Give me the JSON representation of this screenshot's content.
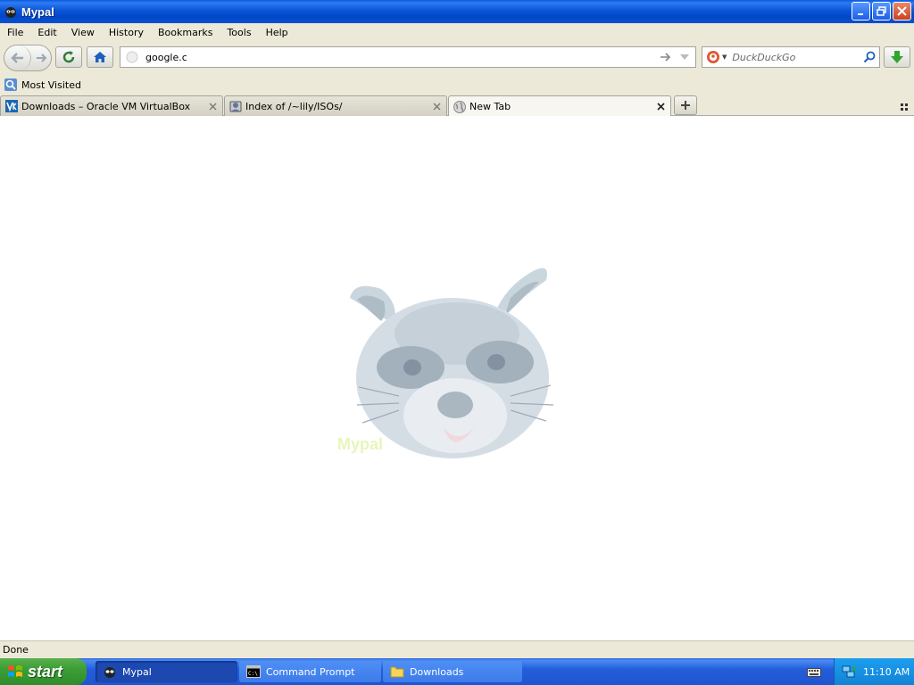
{
  "window": {
    "title": "Mypal"
  },
  "menu": [
    "File",
    "Edit",
    "View",
    "History",
    "Bookmarks",
    "Tools",
    "Help"
  ],
  "navbar": {
    "url_value": "google.c",
    "search_placeholder": "DuckDuckGo"
  },
  "bookmarks": {
    "most_visited": "Most Visited"
  },
  "tabs": [
    {
      "label": "Downloads – Oracle VM VirtualBox",
      "icon": "virtualbox-icon",
      "selected": false
    },
    {
      "label": "Index of /~lily/ISOs/",
      "icon": "directory-icon",
      "selected": false
    },
    {
      "label": "New Tab",
      "icon": "globe-icon",
      "selected": true
    }
  ],
  "content": {
    "mascot_caption": "Mypal"
  },
  "status": {
    "text": "Done"
  },
  "taskbar": {
    "start": "start",
    "tasks": [
      {
        "label": "Mypal",
        "active": true
      },
      {
        "label": "Command Prompt",
        "active": false
      },
      {
        "label": "Downloads",
        "active": false
      }
    ],
    "clock": "11:10 AM"
  },
  "colors": {
    "titlebar": "#0a55d8",
    "chrome": "#ece9d8",
    "taskbar": "#245edb",
    "start": "#3c9e36",
    "tray": "#1283d6"
  }
}
